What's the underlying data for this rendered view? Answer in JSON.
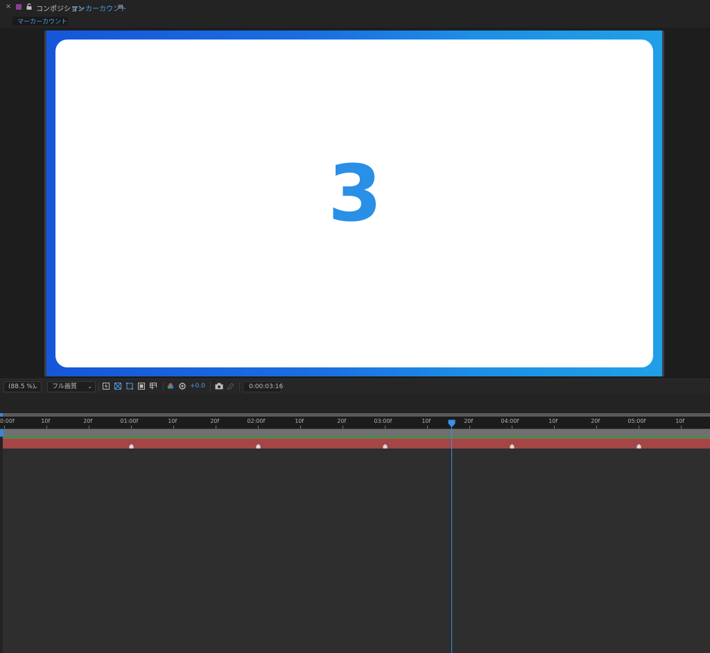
{
  "panel": {
    "close": "×",
    "title_prefix": "コンポジション",
    "title_name": "マーカーカウント",
    "menu": "≡",
    "subtab": "マーカーカウント"
  },
  "canvas": {
    "count_number": "3",
    "colors": {
      "gradient_start": "#1656d9",
      "gradient_end": "#209fe7",
      "number": "#2a8fe6",
      "card": "#ffffff"
    }
  },
  "toolbar": {
    "zoom": "(88.5 %)",
    "quality": "フル画質",
    "exposure": "+0.0",
    "timecode": "0:00:03:16",
    "icons": [
      "transparency-grid-icon",
      "region-of-interest-icon",
      "mask-path-icon",
      "toggle-channel-icon",
      "grid-guides-icon",
      "color-channel-icon",
      "reset-exposure-icon",
      "snapshot-icon",
      "show-snapshot-icon"
    ]
  },
  "timeline": {
    "ruler_labels": [
      "0:00f",
      "10f",
      "20f",
      "01:00f",
      "10f",
      "20f",
      "02:00f",
      "10f",
      "20f",
      "03:00f",
      "10f",
      "20f",
      "04:00f",
      "10f",
      "20f",
      "05:00f",
      "10f"
    ],
    "current_time": "0:00:03:16",
    "layer_markers": [
      "01:00f",
      "02:00f",
      "03:00f",
      "04:00f",
      "05:00f"
    ],
    "colors": {
      "playhead": "#3a8fe9",
      "layer_bar": "#a34646",
      "green_line": "#2b9a3b"
    }
  }
}
